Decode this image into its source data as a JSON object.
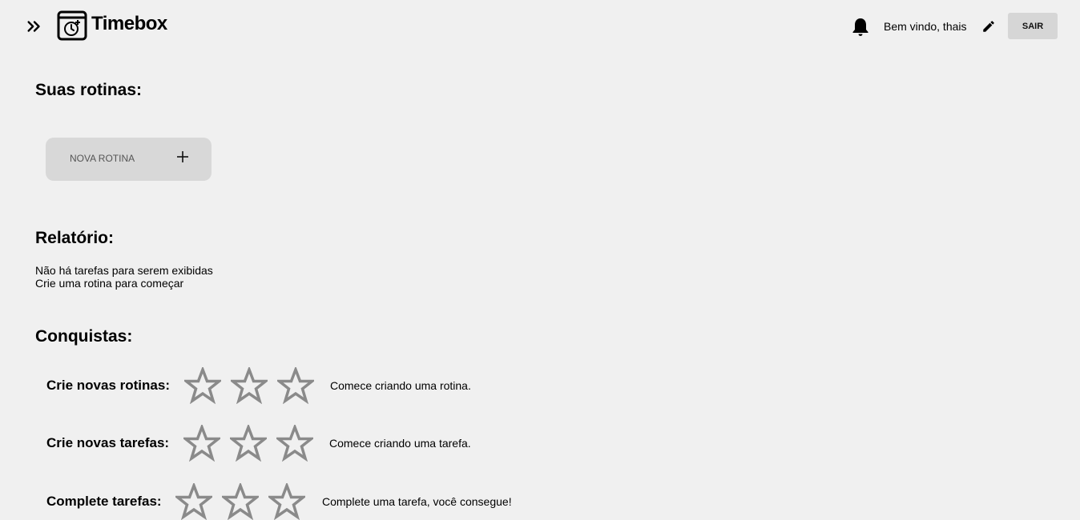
{
  "header": {
    "brand": "Timebox",
    "welcome_text": "Bem vindo, thais",
    "logout_label": "SAIR"
  },
  "routines": {
    "title": "Suas rotinas:",
    "new_routine_label": "NOVA ROTINA"
  },
  "report": {
    "title": "Relatório:",
    "empty_line1": "Não há tarefas para serem exibidas",
    "empty_line2": "Crie uma rotina para começar"
  },
  "achievements": {
    "title": "Conquistas:",
    "star_color": "#8a8a8a",
    "items": [
      {
        "label": "Crie novas rotinas:",
        "stars_earned": 0,
        "stars_total": 3,
        "message": "Comece criando uma rotina."
      },
      {
        "label": "Crie novas tarefas:",
        "stars_earned": 0,
        "stars_total": 3,
        "message": "Comece criando uma tarefa."
      },
      {
        "label": "Complete tarefas:",
        "stars_earned": 0,
        "stars_total": 3,
        "message": "Complete uma tarefa, você consegue!"
      }
    ]
  }
}
